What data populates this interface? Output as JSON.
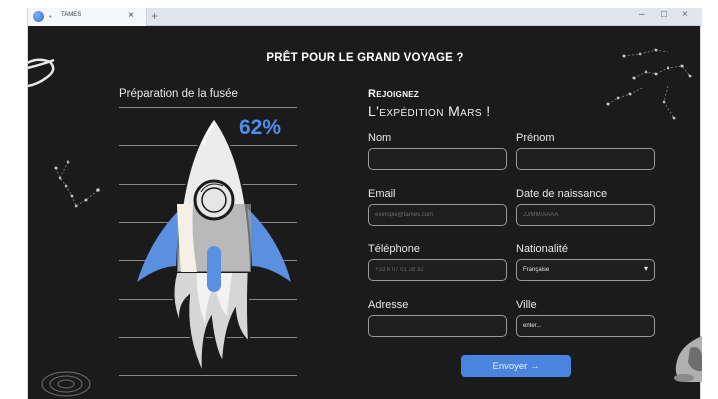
{
  "browser": {
    "tab_title": "TAMES",
    "tab_dot": "•",
    "close_glyph": "×",
    "newtab_glyph": "+",
    "minimize_glyph": "–",
    "maximize_glyph": "□",
    "window_close_glyph": "×"
  },
  "page": {
    "headline": "PRÊT POUR LE GRAND VOYAGE ?",
    "rocket_panel": {
      "label": "Préparation de la fusée",
      "progress_text": "62%",
      "progress_value": 62
    },
    "form": {
      "title_line1": "Rejoignez",
      "title_line2": "L'expédition Mars !",
      "fields": {
        "nom": {
          "label": "Nom",
          "placeholder": "",
          "value": ""
        },
        "prenom": {
          "label": "Prénom",
          "placeholder": "",
          "value": ""
        },
        "email": {
          "label": "Email",
          "placeholder": "exemple@tames.com",
          "value": ""
        },
        "naissance": {
          "label": "Date de naissance",
          "placeholder": "JJ/MM/AAAA",
          "value": ""
        },
        "telephone": {
          "label": "Téléphone",
          "placeholder": "+33 6 07 01 28 32",
          "value": ""
        },
        "nationalite": {
          "label": "Nationalité",
          "value": "Française",
          "caret": "▾"
        },
        "adresse": {
          "label": "Adresse",
          "placeholder": "",
          "value": ""
        },
        "ville": {
          "label": "Ville",
          "placeholder": "",
          "value": "enter..."
        }
      },
      "submit_label": "Envoyer →"
    }
  },
  "colors": {
    "background": "#1b1b1b",
    "accent": "#4a84de",
    "progress_text": "#4d8df0",
    "rocket_body": "#ececec",
    "rocket_shadow": "#cfc7be",
    "rocket_fins": "#5b8fe0",
    "flame": "#d4d4d4"
  },
  "icons": [
    "browser-favicon",
    "planet-icon",
    "constellation-icon",
    "galaxy-icon",
    "astronaut-figure",
    "rocket-illustration"
  ]
}
